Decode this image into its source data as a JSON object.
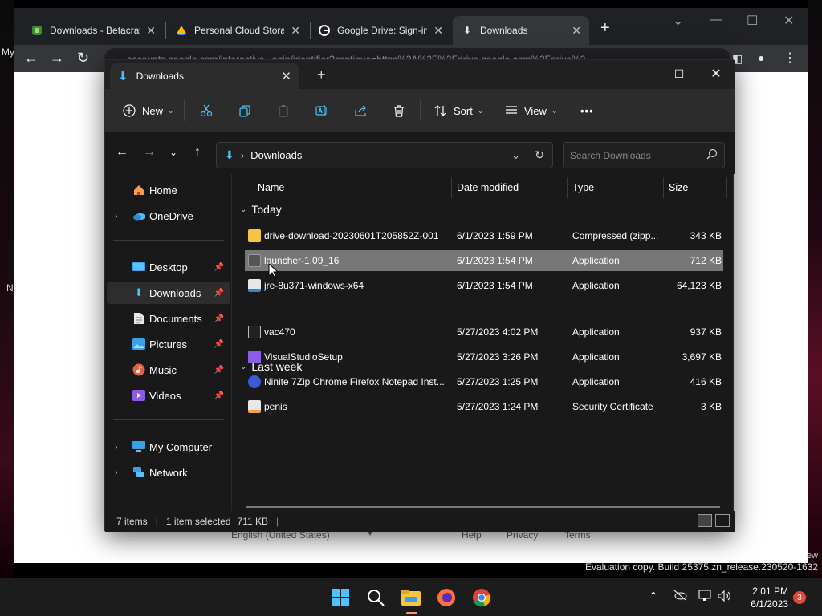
{
  "chrome": {
    "tabs": [
      {
        "title": "Downloads - Betacraf"
      },
      {
        "title": "Personal Cloud Storag"
      },
      {
        "title": "Google Drive: Sign-in"
      },
      {
        "title": "Downloads"
      }
    ],
    "omnibox_text": "accounts.google.com/interactive_login/identifier?continue=https%3A%2F%2Fdrive.google.com%2Fdrive%2",
    "footer": {
      "language": "English (United States)",
      "help": "Help",
      "privacy": "Privacy",
      "terms": "Terms"
    }
  },
  "desktop": {
    "left_text_1": "My",
    "left_text_2": "N",
    "right_text": "ew"
  },
  "explorer": {
    "tab_title": "Downloads",
    "commands": {
      "new": "New",
      "sort": "Sort",
      "view": "View",
      "more": "•••"
    },
    "address": {
      "current": "Downloads"
    },
    "search_placeholder": "Search Downloads",
    "nav": {
      "home": "Home",
      "onedrive": "OneDrive",
      "desktop": "Desktop",
      "downloads": "Downloads",
      "documents": "Documents",
      "pictures": "Pictures",
      "music": "Music",
      "videos": "Videos",
      "mycomputer": "My Computer",
      "network": "Network"
    },
    "columns": {
      "name": "Name",
      "date": "Date modified",
      "type": "Type",
      "size": "Size"
    },
    "groups": {
      "today": "Today",
      "lastweek": "Last week"
    },
    "files": [
      {
        "name": "drive-download-20230601T205852Z-001",
        "date": "6/1/2023 1:59 PM",
        "type": "Compressed (zipp...",
        "size": "343 KB"
      },
      {
        "name": "launcher-1.09_16",
        "date": "6/1/2023 1:54 PM",
        "type": "Application",
        "size": "712 KB"
      },
      {
        "name": "jre-8u371-windows-x64",
        "date": "6/1/2023 1:54 PM",
        "type": "Application",
        "size": "64,123 KB"
      },
      {
        "name": "vac470",
        "date": "5/27/2023 4:02 PM",
        "type": "Application",
        "size": "937 KB"
      },
      {
        "name": "VisualStudioSetup",
        "date": "5/27/2023 3:26 PM",
        "type": "Application",
        "size": "3,697 KB"
      },
      {
        "name": "Ninite 7Zip Chrome Firefox Notepad Inst...",
        "date": "5/27/2023 1:25 PM",
        "type": "Application",
        "size": "416 KB"
      },
      {
        "name": "penis",
        "date": "5/27/2023 1:24 PM",
        "type": "Security Certificate",
        "size": "3 KB"
      }
    ],
    "status": {
      "items": "7 items",
      "selected": "1 item selected",
      "selected_size": "711 KB"
    }
  },
  "watermark": "Evaluation copy. Build 25375.zn_release.230520-1632",
  "taskbar": {
    "time": "2:01 PM",
    "date": "6/1/2023",
    "notifications": "3"
  },
  "colors": {
    "accent": "#4cc2ff",
    "selected_row": "#777777",
    "folder": "#f4c542"
  }
}
